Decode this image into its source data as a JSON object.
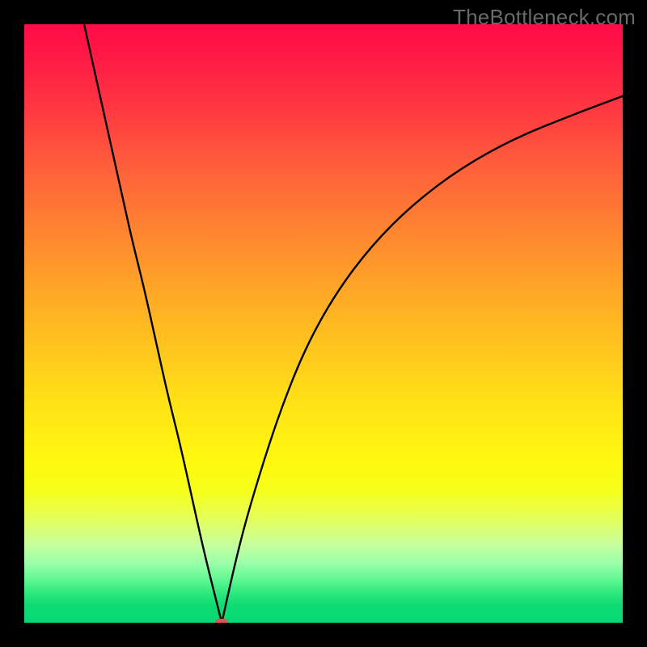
{
  "watermark": "TheBottleneck.com",
  "colors": {
    "frame": "#000000",
    "curve": "#000000",
    "marker": "#d85a50",
    "gradient_top": "#ff0b47",
    "gradient_bottom": "#04d873"
  },
  "chart_data": {
    "type": "line",
    "title": "",
    "xlabel": "",
    "ylabel": "",
    "xlim": [
      0,
      100
    ],
    "ylim": [
      0,
      100
    ],
    "grid": false,
    "annotations": [],
    "legend": [],
    "series": [
      {
        "name": "left-branch",
        "x": [
          10,
          12,
          14,
          16,
          18,
          20,
          22,
          24,
          26,
          28,
          30,
          32,
          33
        ],
        "values": [
          100,
          91,
          82,
          73,
          64,
          56,
          47,
          38,
          30,
          21,
          12,
          4,
          0
        ]
      },
      {
        "name": "right-branch",
        "x": [
          33,
          35,
          37,
          40,
          43,
          47,
          52,
          58,
          65,
          73,
          82,
          92,
          100
        ],
        "values": [
          0,
          9,
          17,
          27,
          36,
          46,
          55,
          63,
          70,
          76,
          81,
          85,
          88
        ]
      }
    ],
    "marker": {
      "x": 33,
      "y": 0
    },
    "background_gradient_hint": "vertical red→orange→yellow→green heatmap"
  }
}
